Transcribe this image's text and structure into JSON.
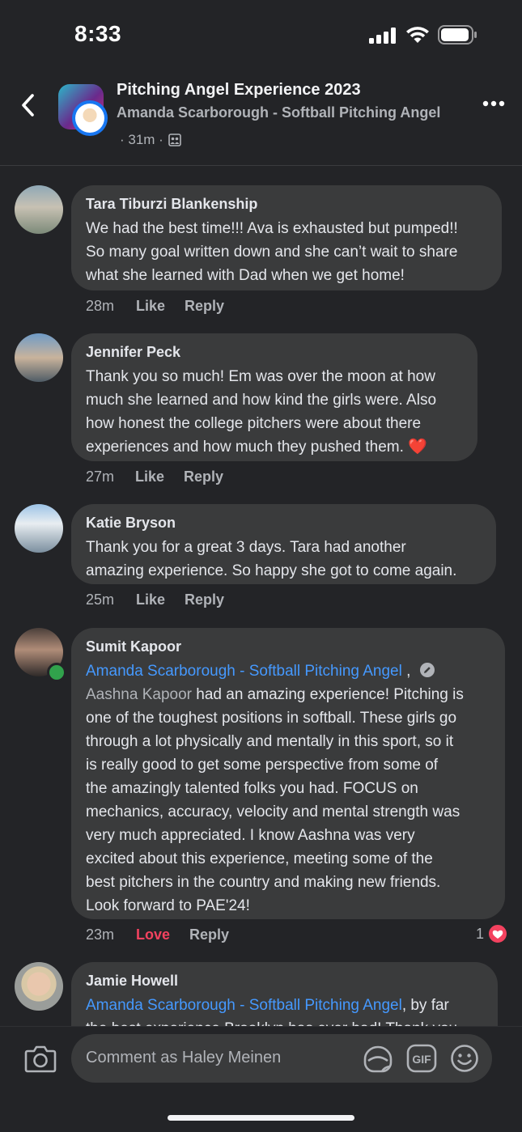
{
  "status_bar": {
    "time": "8:33"
  },
  "header": {
    "title": "Pitching Angel Experience 2023",
    "author": "Amanda Scarborough - Softball Pitching Angel",
    "meta": "· 31m ·"
  },
  "comments": [
    {
      "name": "Tara Tiburzi Blankenship",
      "lines": [
        "We had the best time!!! Ava is exhausted but pumped!!",
        "So many goal written down and she can’t wait to share",
        "what she learned with Dad when we get home!"
      ],
      "time": "28m",
      "like": "Like",
      "reply": "Reply"
    },
    {
      "name": "Jennifer Peck",
      "lines": [
        "Thank you so much! Em was over the moon at how",
        "much she learned and how kind the girls were. Also",
        "how honest the college pitchers were about there",
        "experiences and how much they pushed them. ❤️"
      ],
      "time": "27m",
      "like": "Like",
      "reply": "Reply"
    },
    {
      "name": "Katie Bryson",
      "lines": [
        "Thank you for a great 3 days. Tara had another",
        "amazing experience. So happy she got to come again."
      ],
      "time": "25m",
      "like": "Like",
      "reply": "Reply"
    },
    {
      "name": "Sumit Kapoor",
      "mention": "Amanda Scarborough - Softball Pitching Angel",
      "mention_suffix": " ,",
      "tagged": "Aashna Kapoor",
      "tagged_suffix": " had an amazing experience! Pitching is",
      "lines": [
        "one of the toughest positions in softball. These girls go",
        "through a lot physically and mentally in this sport, so it",
        "is really good to get some perspective from some of",
        "the amazingly talented folks you had. FOCUS on",
        "mechanics, accuracy, velocity and mental strength was",
        "very much appreciated. I know Aashna was very",
        "excited about this experience, meeting some of the",
        "best pitchers in the country and making new friends.",
        "Look forward to PAE'24!"
      ],
      "time": "23m",
      "like": "Love",
      "reply": "Reply",
      "reaction_count": "1"
    },
    {
      "name": "Jamie Howell",
      "mention": "Amanda Scarborough - Softball Pitching Angel",
      "mention_suffix": ", by far",
      "lines": [
        "the best experience Brooklyn has ever had! Thank you"
      ]
    }
  ],
  "composer": {
    "placeholder": "Comment as Haley Meinen"
  },
  "colors": {
    "background": "#232427",
    "bubble": "#3a3b3c",
    "mention": "#4599ff",
    "love": "#f3425f"
  },
  "icons": [
    "back-chevron-icon",
    "more-icon",
    "camera-icon",
    "sticker-icon",
    "gif-icon",
    "emoji-icon",
    "signal-icon",
    "wifi-icon",
    "battery-icon",
    "heart-reaction-icon"
  ]
}
